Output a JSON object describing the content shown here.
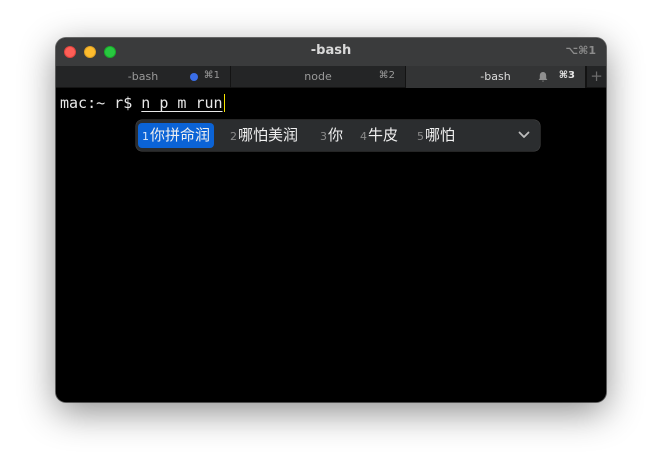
{
  "window": {
    "title": "-bash",
    "title_shortcut": "⌥⌘1"
  },
  "tabs": [
    {
      "label": "-bash",
      "shortcut": "⌘1",
      "indicator": "blue-dot"
    },
    {
      "label": "node",
      "shortcut": "⌘2"
    },
    {
      "label": "-bash",
      "shortcut": "⌘3",
      "indicator": "bell-icon",
      "active": true
    }
  ],
  "new_tab_label": "+",
  "terminal": {
    "prompt": "mac:~ r$ ",
    "composition": "n p m run"
  },
  "ime": {
    "candidates": [
      {
        "num": "1",
        "text": "你拼命润",
        "selected": true
      },
      {
        "num": "2",
        "text": "哪怕美润"
      },
      {
        "num": "3",
        "text": "你"
      },
      {
        "num": "4",
        "text": "牛皮"
      },
      {
        "num": "5",
        "text": "哪怕"
      }
    ],
    "expand_icon": "chevron-down-icon"
  },
  "colors": {
    "accent": "#0b63d6",
    "caret": "#f5e400",
    "tab_dot": "#3a6ee8"
  }
}
